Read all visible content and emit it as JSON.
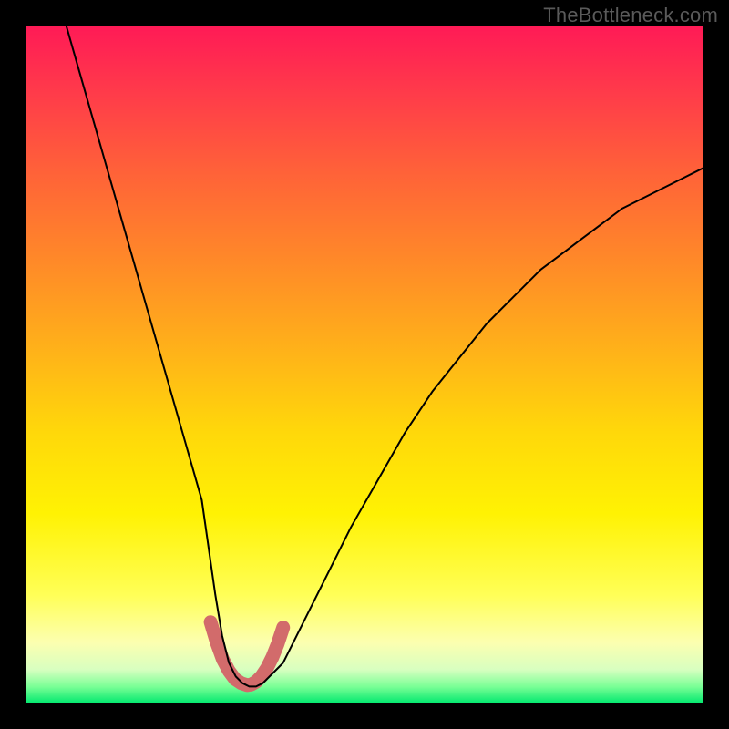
{
  "watermark": "TheBottleneck.com",
  "chart_data": {
    "type": "line",
    "title": "",
    "xlabel": "",
    "ylabel": "",
    "xlim": [
      0,
      100
    ],
    "ylim": [
      0,
      100
    ],
    "grid": false,
    "legend": false,
    "series": [
      {
        "name": "main-curve",
        "x": [
          6,
          8,
          10,
          12,
          14,
          16,
          18,
          20,
          22,
          24,
          26,
          27,
          28,
          29,
          30,
          31,
          32,
          33,
          34,
          35,
          36,
          38,
          40,
          44,
          48,
          52,
          56,
          60,
          64,
          68,
          72,
          76,
          80,
          84,
          88,
          92,
          96,
          100
        ],
        "y": [
          100,
          93,
          86,
          79,
          72,
          65,
          58,
          51,
          44,
          37,
          30,
          23,
          16,
          10,
          6,
          4,
          3,
          2.5,
          2.5,
          3,
          4,
          6,
          10,
          18,
          26,
          33,
          40,
          46,
          51,
          56,
          60,
          64,
          67,
          70,
          73,
          75,
          77,
          79
        ]
      },
      {
        "name": "highlight-v",
        "x": [
          27.3,
          28.2,
          29.1,
          30.0,
          30.9,
          31.8,
          32.7,
          33.3,
          34.0,
          34.8,
          35.6,
          36.4,
          37.2,
          38.0
        ],
        "y": [
          12.0,
          9.0,
          6.5,
          4.8,
          3.6,
          3.0,
          2.7,
          2.8,
          3.2,
          4.0,
          5.2,
          6.8,
          8.8,
          11.2
        ]
      }
    ],
    "background_gradient": {
      "stops": [
        {
          "pos": 0.0,
          "color": "#ff1a56"
        },
        {
          "pos": 0.1,
          "color": "#ff3b4a"
        },
        {
          "pos": 0.22,
          "color": "#ff6338"
        },
        {
          "pos": 0.35,
          "color": "#ff8a28"
        },
        {
          "pos": 0.48,
          "color": "#ffb219"
        },
        {
          "pos": 0.6,
          "color": "#ffd80a"
        },
        {
          "pos": 0.72,
          "color": "#fff203"
        },
        {
          "pos": 0.84,
          "color": "#ffff57"
        },
        {
          "pos": 0.91,
          "color": "#fcffb0"
        },
        {
          "pos": 0.95,
          "color": "#d8ffc0"
        },
        {
          "pos": 0.975,
          "color": "#7bff96"
        },
        {
          "pos": 1.0,
          "color": "#00e86e"
        }
      ]
    },
    "annotations": []
  },
  "colors": {
    "curve": "#000000",
    "highlight": "#d26b6b",
    "frame": "#000000"
  }
}
